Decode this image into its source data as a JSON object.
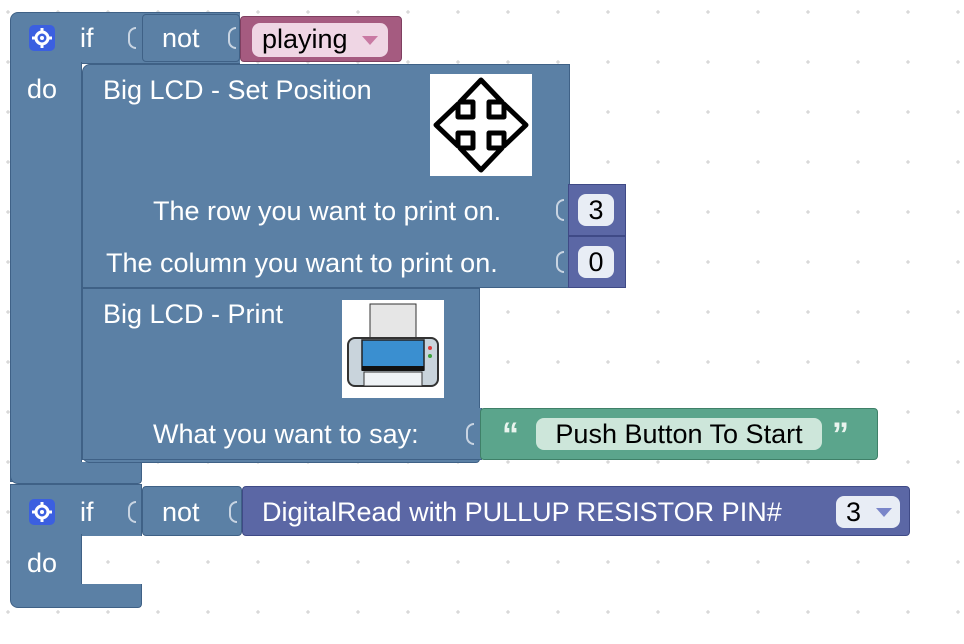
{
  "if1": {
    "if_label": "if",
    "do_label": "do",
    "not_label": "not",
    "variable": "playing"
  },
  "set_position": {
    "title": "Big LCD - Set Position",
    "row_label": "The row you want to print on.",
    "row_value": "3",
    "column_label": "The column you want to print on.",
    "column_value": "0",
    "icon": "move-arrows-icon"
  },
  "print": {
    "title": "Big LCD - Print",
    "say_label": "What you want to say:",
    "open_quote": "“",
    "text_value": "Push Button To Start",
    "close_quote": "”",
    "icon": "printer-icon"
  },
  "if2": {
    "if_label": "if",
    "do_label": "do",
    "not_label": "not",
    "digital_read_label": "DigitalRead with PULLUP RESISTOR PIN#",
    "pin_value": "3"
  },
  "colors": {
    "control": "#5b80a5",
    "variable": "#a55b80",
    "math": "#5b67a5",
    "text": "#5ba58c",
    "gear": "#3b5fe0"
  }
}
